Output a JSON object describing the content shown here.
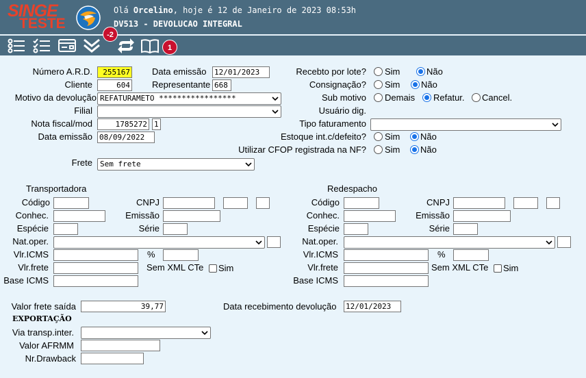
{
  "header": {
    "logo_top": "SINGE",
    "logo_bottom": "TESTE",
    "greeting_prefix": "Olá ",
    "user": "Orcelino",
    "greeting_suffix": ", hoje é 12 de Janeiro de 2023 08:53h",
    "screen_title": "DV513 - DEVOLUCAO INTEGRAL"
  },
  "toolbar": {
    "icons": [
      "list-icon",
      "checklist-icon",
      "card-icon",
      "double-chevron-down-icon",
      "refresh-icon",
      "book-icon"
    ],
    "badge_refresh": "-2",
    "badge_book": "1"
  },
  "colors": {
    "header_bg": "#4a6b80",
    "page_bg": "#e9f4fb",
    "logo": "#e8422a",
    "badge": "#c8102e",
    "highlight": "#ffff22",
    "radio_on": "#1a73e8"
  },
  "form": {
    "numero_ard_label": "Número A.R.D.",
    "numero_ard": "255167",
    "data_emissao_label": "Data emissão",
    "data_emissao": "12/01/2023",
    "cliente_label": "Cliente",
    "cliente": "604",
    "representante_label": "Representante",
    "representante": "668",
    "motivo_label": "Motivo da devolução",
    "motivo": "REFATURAMETO *****************",
    "filial_label": "Filial",
    "filial": "",
    "nota_label": "Nota fiscal/mod",
    "nota": "1785272",
    "nota_mod": "1",
    "data_emissao_nf_label": "Data emissão",
    "data_emissao_nf": "08/09/2022",
    "frete_label": "Frete",
    "frete": "Sem frete",
    "recebto_label": "Recebto por lote?",
    "consignacao_label": "Consignação?",
    "sub_motivo_label": "Sub motivo",
    "usuario_label": "Usuário dig.",
    "tipo_fat_label": "Tipo faturamento",
    "tipo_fat": "",
    "estoque_label": "Estoque int.c/defeito?",
    "cfop_label": "Utilizar CFOP registrada na NF?",
    "sim": "Sim",
    "nao": "Não",
    "demais": "Demais",
    "refatur": "Refatur.",
    "cancel": "Cancel."
  },
  "transportadora": {
    "title": "Transportadora",
    "codigo": "Código",
    "cnpj": "CNPJ",
    "conhec": "Conhec.",
    "emissao": "Emissão",
    "especie": "Espécie",
    "serie": "Série",
    "nat_oper": "Nat.oper.",
    "vlr_icms": "Vlr.ICMS",
    "pct": "%",
    "vlr_frete": "Vlr.frete",
    "sem_xml": "Sem XML CTe",
    "sim": "Sim",
    "base_icms": "Base ICMS"
  },
  "redespacho": {
    "title": "Redespacho",
    "codigo": "Código",
    "cnpj": "CNPJ",
    "conhec": "Conhec.",
    "emissao": "Emissão",
    "especie": "Espécie",
    "serie": "Série",
    "nat_oper": "Nat.oper.",
    "vlr_icms": "Vlr.ICMS",
    "pct": "%",
    "vlr_frete": "Vlr.frete",
    "sem_xml": "Sem XML CTe",
    "sim": "Sim",
    "base_icms": "Base ICMS"
  },
  "footer": {
    "valor_frete_label": "Valor frete saída",
    "valor_frete": "39,77",
    "data_receb_label": "Data recebimento devolução",
    "data_receb": "12/01/2023",
    "exportacao": "EXPORTAÇÃO",
    "via_label": "Via transp.inter.",
    "via": "",
    "afrmm_label": "Valor AFRMM",
    "drawback_label": "Nr.Drawback"
  }
}
